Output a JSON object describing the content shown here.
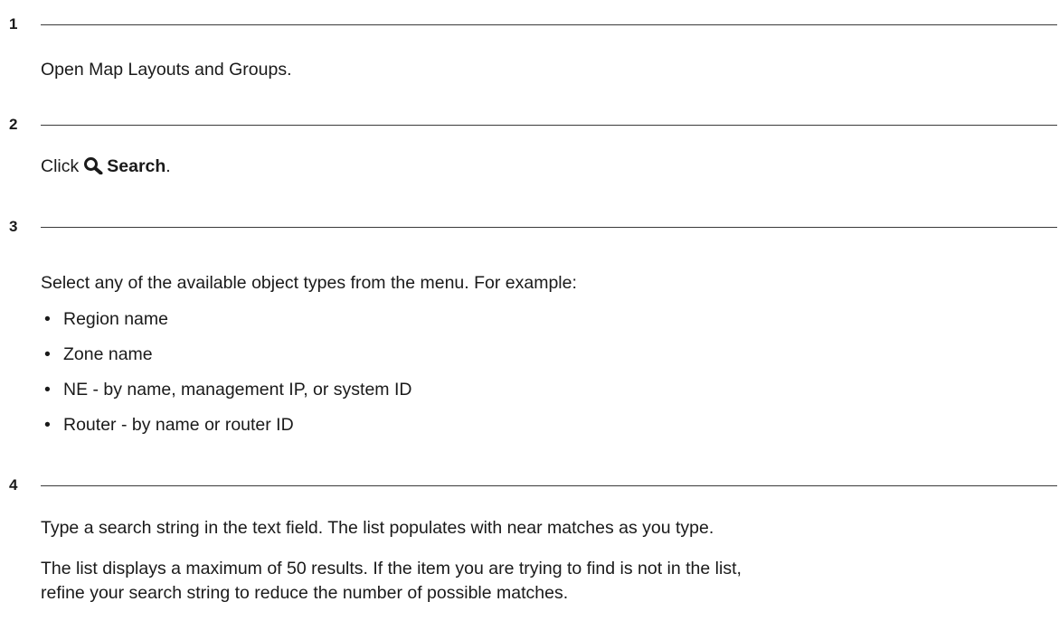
{
  "steps": [
    {
      "number": "1",
      "text": "Open Map Layouts and Groups."
    },
    {
      "number": "2",
      "prefix": "Click",
      "icon": "search-icon",
      "bold_label": "Search",
      "suffix": "."
    },
    {
      "number": "3",
      "intro": "Select any of the available object types from the menu. For example:",
      "bullet_glyph": "•",
      "bullets": [
        "Region name",
        "Zone name",
        "NE - by name, management IP, or system ID",
        "Router - by name or router ID"
      ]
    },
    {
      "number": "4",
      "para1": "Type a search string in the text field. The list populates with near matches as you type.",
      "para2_line1": "The list displays a maximum of 50 results. If the item you are trying to find is not in the list,",
      "para2_line2": "refine your search string to reduce the number of possible matches."
    }
  ]
}
